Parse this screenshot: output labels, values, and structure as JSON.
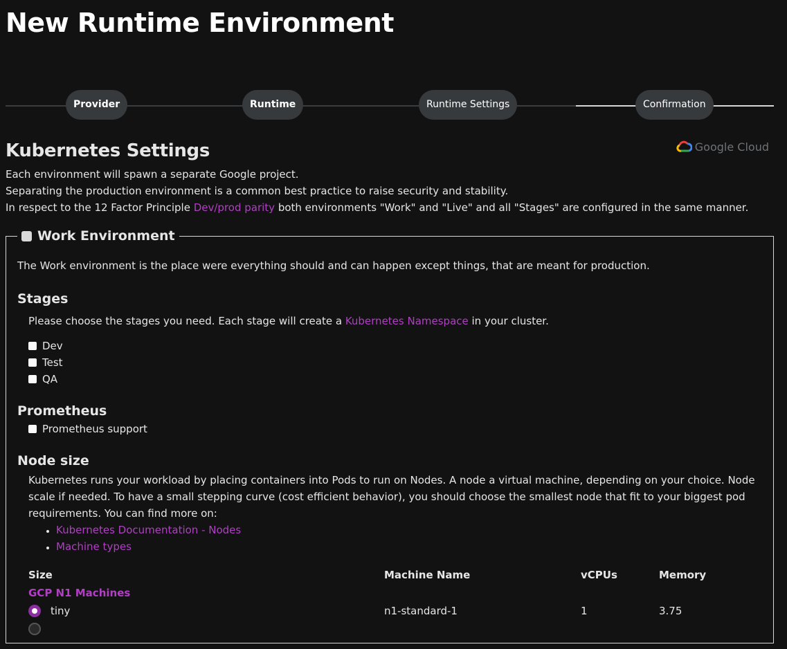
{
  "page": {
    "title": "New Runtime Environment"
  },
  "stepper": {
    "steps": [
      {
        "label": "Provider",
        "state": "done"
      },
      {
        "label": "Runtime",
        "state": "done"
      },
      {
        "label": "Runtime Settings",
        "state": "current"
      },
      {
        "label": "Confirmation",
        "state": "todo"
      }
    ]
  },
  "settings": {
    "heading": "Kubernetes Settings",
    "provider_logo_text": "Google Cloud",
    "intro_line1": "Each environment will spawn a separate Google project.",
    "intro_line2": "Separating the production environment is a common best practice to raise security and stability.",
    "intro_line3_before": "In respect to the 12 Factor Principle ",
    "intro_line3_link": "Dev/prod parity",
    "intro_line3_after": " both environments \"Work\" and \"Live\" and all \"Stages\" are configured in the same manner."
  },
  "work_env": {
    "legend": "Work Environment",
    "enabled": false,
    "description": "The Work environment is the place were everything should and can happen except things, that are meant for production.",
    "stages": {
      "heading": "Stages",
      "desc_before": "Please choose the stages you need. Each stage will create a ",
      "desc_link": "Kubernetes Namespace",
      "desc_after": " in your cluster.",
      "options": [
        {
          "label": "Dev",
          "checked": false
        },
        {
          "label": "Test",
          "checked": false
        },
        {
          "label": "QA",
          "checked": false
        }
      ]
    },
    "prometheus": {
      "heading": "Prometheus",
      "option_label": "Prometheus support",
      "checked": false
    },
    "node_size": {
      "heading": "Node size",
      "description": "Kubernetes runs your workload by placing containers into Pods to run on Nodes. A node a virtual machine, depending on your choice. Node scale if needed. To have a small stepping curve (cost efficient behavior), you should choose the smallest node that fit to your biggest pod requirements. You can find more on:",
      "links": [
        "Kubernetes Documentation - Nodes",
        "Machine types"
      ],
      "table": {
        "headers": {
          "size": "Size",
          "machine_name": "Machine Name",
          "vcpus": "vCPUs",
          "memory": "Memory"
        },
        "group_label": "GCP N1 Machines",
        "rows": [
          {
            "size": "tiny",
            "machine_name": "n1-standard-1",
            "vcpus": "1",
            "memory": "3.75",
            "selected": true
          }
        ]
      }
    }
  },
  "colors": {
    "background": "#121212",
    "accent": "#b03fc4",
    "radio_selected": "#8b2fa0",
    "step_pill": "#373a3d"
  }
}
